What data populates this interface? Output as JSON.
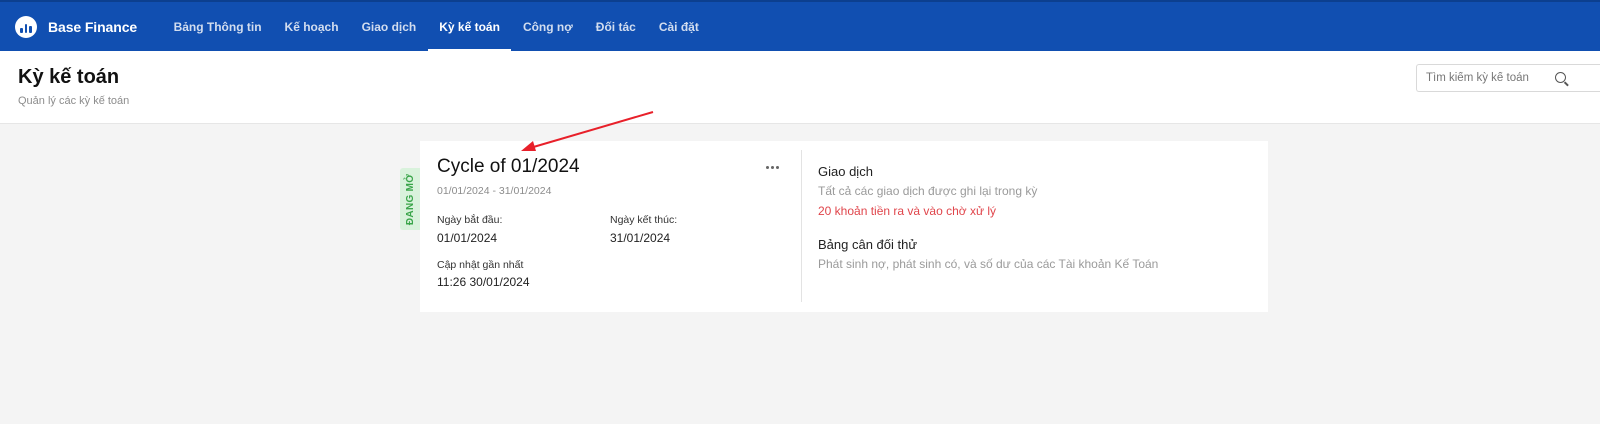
{
  "app": {
    "brand": "Base Finance"
  },
  "nav": {
    "items": [
      {
        "label": "Bảng Thông tin"
      },
      {
        "label": "Kế hoạch"
      },
      {
        "label": "Giao dịch"
      },
      {
        "label": "Kỳ kế toán",
        "active": true
      },
      {
        "label": "Công nợ"
      },
      {
        "label": "Đối tác"
      },
      {
        "label": "Cài đặt"
      }
    ]
  },
  "header": {
    "title": "Kỳ kế toán",
    "subtitle": "Quản lý các kỳ kế toán",
    "search_placeholder": "Tìm kiếm kỳ kế toán"
  },
  "cycle": {
    "status": "ĐANG MỞ",
    "title": "Cycle of 01/2024",
    "range": "01/01/2024 - 31/01/2024",
    "start_label": "Ngày bắt đầu:",
    "start_value": "01/01/2024",
    "end_label": "Ngày kết thúc:",
    "end_value": "31/01/2024",
    "updated_label": "Cập nhật gần nhất",
    "updated_value": "11:26 30/01/2024"
  },
  "links": {
    "transactions_title": "Giao dịch",
    "transactions_desc": "Tất cả các giao dịch được ghi lại trong kỳ",
    "transactions_warning": "20 khoản tiền ra và vào chờ xử lý",
    "trial_balance_title": "Bảng cân đối thử",
    "trial_balance_desc": "Phát sinh nợ, phát sinh có, và số dư của các Tài khoản Kế Toán"
  },
  "colors": {
    "topbar": "#114fb1",
    "status_text": "#3aa54a",
    "status_bg": "#d9f2dc",
    "warning": "#e0454b",
    "annotation_arrow": "#e8202a"
  }
}
